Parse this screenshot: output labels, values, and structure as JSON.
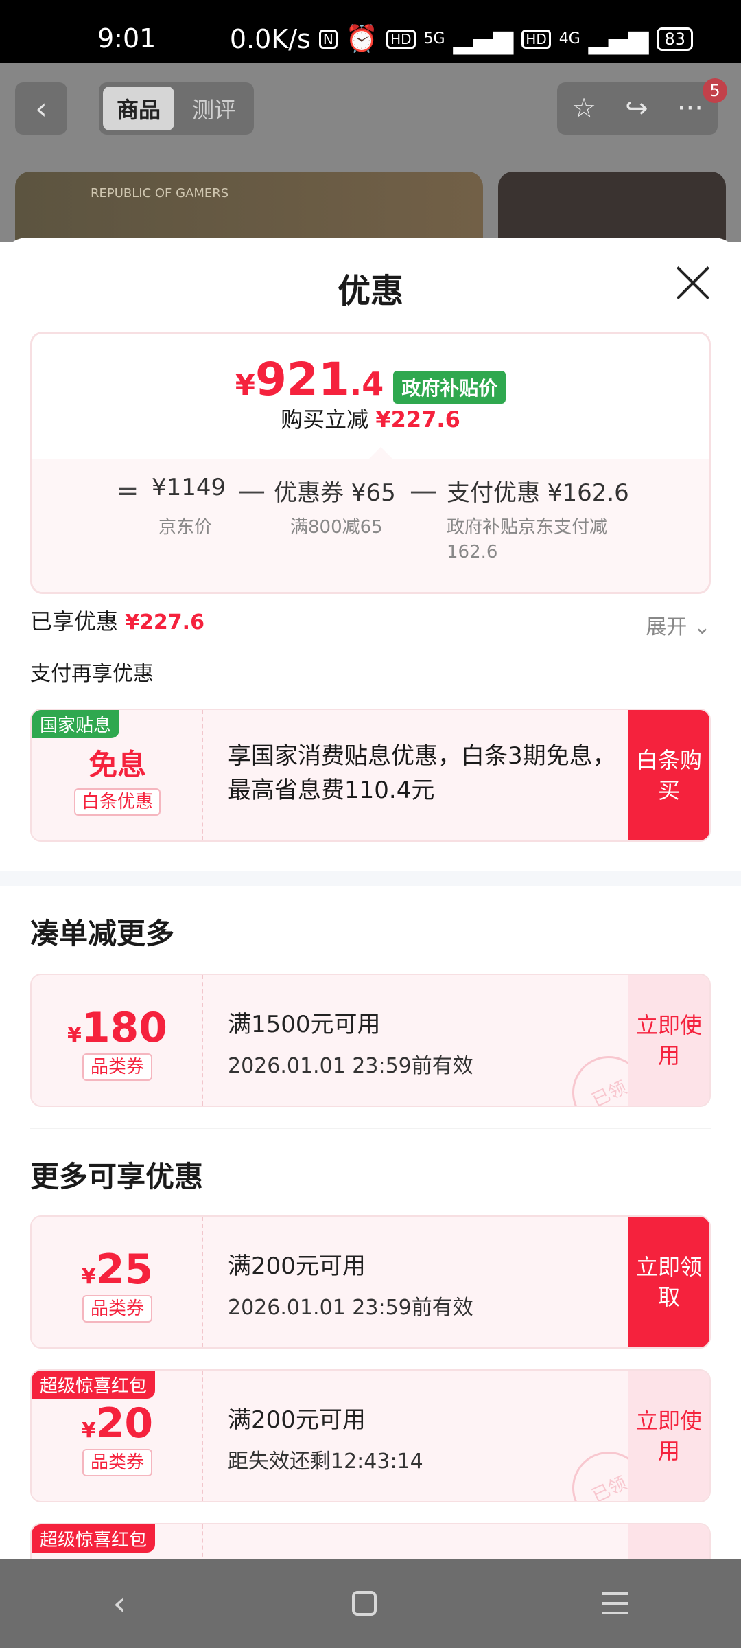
{
  "status": {
    "time": "9:01",
    "speed": "0.0K/s",
    "hd": "HD",
    "net5g": "5G",
    "net4g": "4G",
    "battery": "83"
  },
  "header": {
    "back_icon": "chevron-left-icon",
    "tabs": [
      {
        "label": "商品",
        "active": true
      },
      {
        "label": "测评",
        "active": false
      }
    ],
    "badge": "5"
  },
  "banner": {
    "brand": "REPUBLIC OF GAMERS"
  },
  "sheet": {
    "title": "优惠",
    "price": {
      "yen": "¥",
      "integer": "921",
      "decimal": ".4",
      "tag": "政府补贴价",
      "reduce_label": "购买立减",
      "reduce_value": "¥227.6"
    },
    "calc": {
      "eq": "=",
      "minus": "—",
      "items": [
        {
          "value": "¥1149",
          "sub": "京东价"
        },
        {
          "value": "优惠券 ¥65",
          "sub": "满800减65"
        },
        {
          "value": "支付优惠 ¥162.6",
          "sub": "政府补贴京东支付减162.6"
        }
      ]
    },
    "enjoyed": {
      "label": "已享优惠",
      "value": "¥227.6",
      "expand": "展开"
    },
    "pay_more": "支付再享优惠",
    "baitiao": {
      "tag": "国家贴息",
      "big": "免息",
      "cat": "白条优惠",
      "text": "享国家消费贴息优惠，白条3期免息，最高省息费110.4元",
      "btn": "白条购买"
    },
    "section1": "凑单减更多",
    "coupon1": {
      "yen": "¥",
      "amount": "180",
      "cat": "品类券",
      "l1": "满1500元可用",
      "l2": "2026.01.01 23:59前有效",
      "btn": "立即使用",
      "stamp": "已领"
    },
    "section2": "更多可享优惠",
    "coupon2": {
      "yen": "¥",
      "amount": "25",
      "cat": "品类券",
      "l1": "满200元可用",
      "l2": "2026.01.01 23:59前有效",
      "btn": "立即领取"
    },
    "coupon3": {
      "tag": "超级惊喜红包",
      "yen": "¥",
      "amount": "20",
      "cat": "品类券",
      "l1": "满200元可用",
      "l2": "距失效还剩12:43:14",
      "btn": "立即使用",
      "stamp": "已领"
    },
    "coupon4": {
      "tag": "超级惊喜红包"
    }
  },
  "colors": {
    "accent": "#f5223d",
    "green": "#2fa84f"
  }
}
